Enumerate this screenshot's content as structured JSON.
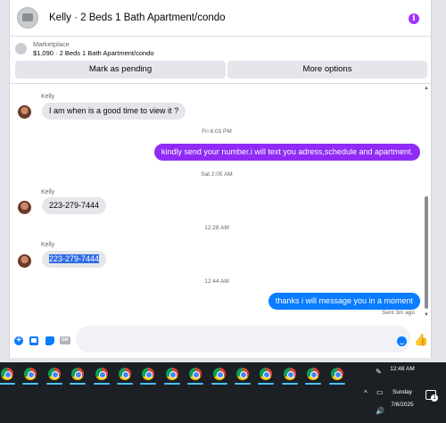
{
  "header": {
    "title": "Kelly · 2 Beds 1 Bath Apartment/condo",
    "info_icon": "i"
  },
  "listing": {
    "category": "Marketplace",
    "summary": "$1,090 · 2 Beds 1 Bath Apartment/condo",
    "buttons": {
      "pending": "Mark as pending",
      "more": "More options"
    }
  },
  "messages": [
    {
      "sender": "Kelly",
      "text": "I am when is a good time to view it ?"
    },
    {
      "time": "Fri 6:03 PM"
    },
    {
      "outgoing": true,
      "text": "kindly send your number.i will text you adress,schedule and apartment."
    },
    {
      "time": "Sat 2:05 AM"
    },
    {
      "sender": "Kelly",
      "text": "223-279-7444"
    },
    {
      "time": "12:28 AM"
    },
    {
      "sender": "Kelly",
      "text": "223-279-7444"
    },
    {
      "time": "12:44 AM"
    },
    {
      "outgoing": true,
      "text": "thanks i will message you in a moment"
    }
  ],
  "sent_status": "Sent 3m ago",
  "composer": {
    "placeholder": "",
    "gif_label": "GIF"
  },
  "taskbar": {
    "time": "12:48 AM",
    "day": "Sunday",
    "date": "7/6/2025",
    "notification_count": "1",
    "app_count": 15
  },
  "colors": {
    "accent": "#0a7cff",
    "purple_bubble": "#8f2bf5",
    "info": "#a033ff"
  }
}
